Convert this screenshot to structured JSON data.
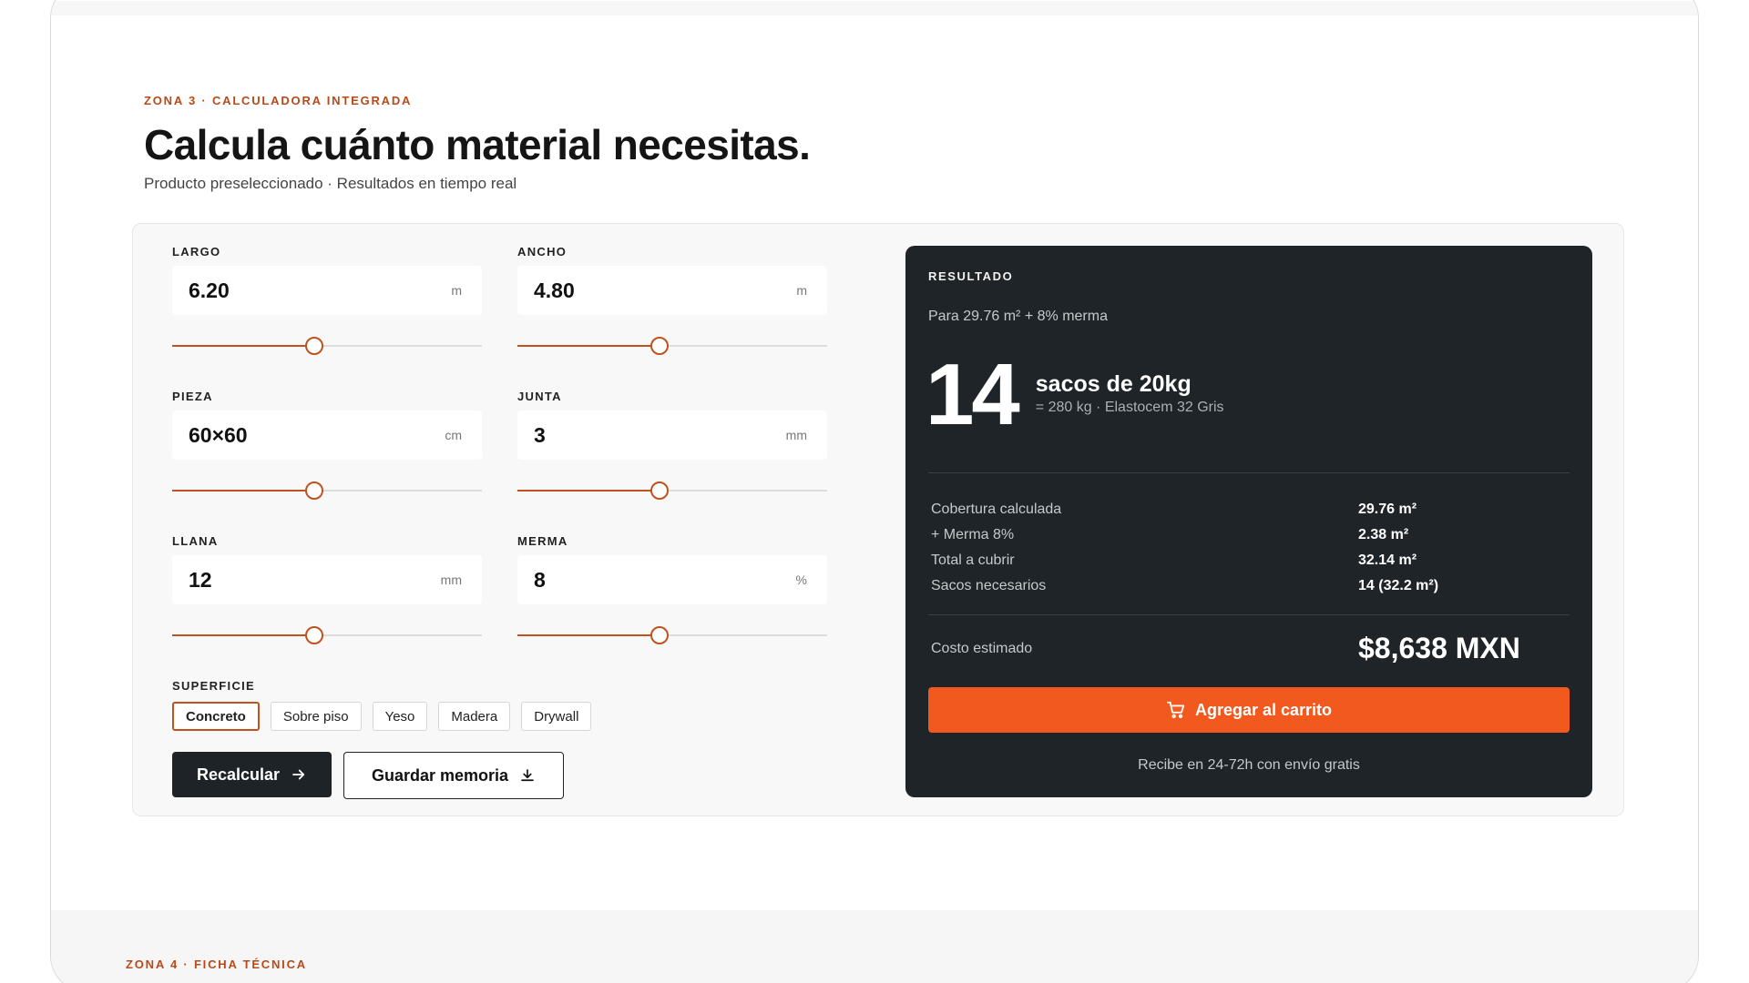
{
  "zone3": {
    "eyebrow": "ZONA 3 · CALCULADORA INTEGRADA",
    "title": "Calcula cuánto material necesitas.",
    "subtitle": "Producto preseleccionado · Resultados en tiempo real"
  },
  "fields": [
    {
      "label": "LARGO",
      "value": "6.20",
      "unit": "m",
      "slider": 0.46
    },
    {
      "label": "ANCHO",
      "value": "4.80",
      "unit": "m",
      "slider": 0.46
    },
    {
      "label": "PIEZA",
      "value": "60×60",
      "unit": "cm",
      "slider": 0.46
    },
    {
      "label": "JUNTA",
      "value": "3",
      "unit": "mm",
      "slider": 0.46
    },
    {
      "label": "LLANA",
      "value": "12",
      "unit": "mm",
      "slider": 0.46
    },
    {
      "label": "MERMA",
      "value": "8",
      "unit": "%",
      "slider": 0.46
    }
  ],
  "surface": {
    "label": "SUPERFICIE",
    "options": [
      "Concreto",
      "Sobre piso",
      "Yeso",
      "Madera",
      "Drywall"
    ],
    "selected": "Concreto"
  },
  "actions": {
    "recalc": "Recalcular",
    "save": "Guardar memoria"
  },
  "result": {
    "eyebrow": "RESULTADO",
    "for": "Para 29.76 m² + 8% merma",
    "number": "14",
    "unit": "sacos de 20kg",
    "detail": "= 280 kg · Elastocem 32 Gris",
    "rows": [
      {
        "k": "Cobertura calculada",
        "v": "29.76 m²"
      },
      {
        "k": "+ Merma 8%",
        "v": "2.38 m²"
      },
      {
        "k": "Total a cubrir",
        "v": "32.14 m²"
      },
      {
        "k": "Sacos necesarios",
        "v": "14 (32.2 m²)"
      }
    ],
    "cost_label": "Costo estimado",
    "cost_value": "$8,638 MXN",
    "cta": "Agregar al carrito",
    "shipping": "Recibe en 24-72h con envío gratis"
  },
  "zone4": {
    "eyebrow": "ZONA 4 · FICHA TÉCNICA"
  },
  "colors": {
    "accent": "#c0521f",
    "cta": "#f2591e",
    "dark": "#1e2427"
  }
}
